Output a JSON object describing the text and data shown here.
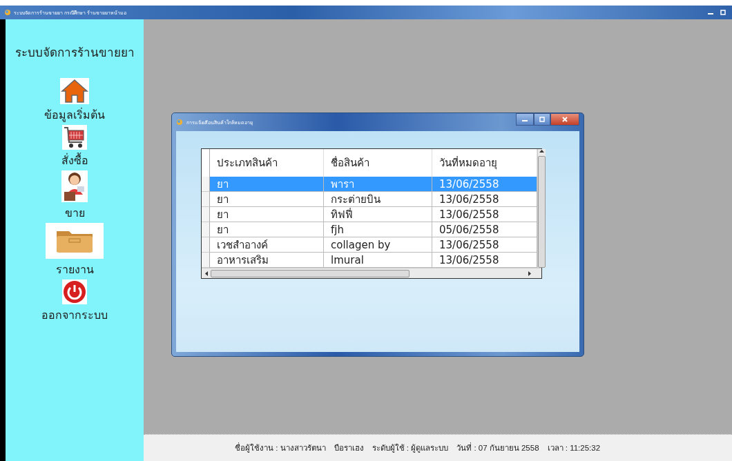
{
  "window": {
    "title": "ระบบจัดการร้านขายยา กรณีศึกษา ร้านขายยาหน้ามอ"
  },
  "sidebar": {
    "heading": "ระบบจัดการร้านขายยา",
    "items": [
      {
        "kind": "home",
        "label": "ข้อมูลเริ่มต้น"
      },
      {
        "kind": "cart",
        "label": "สั่งซื้อ"
      },
      {
        "kind": "seller",
        "label": "ขาย"
      },
      {
        "kind": "folder",
        "label": "รายงาน"
      },
      {
        "kind": "power",
        "label": "ออกจากระบบ"
      }
    ]
  },
  "dialog": {
    "title": "การแจ้งเตือนสินค้าใกล้หมดอายุ",
    "table": {
      "columns": [
        "ประเภทสินค้า",
        "ชื่อสินค้า",
        "วันที่หมดอายุ"
      ],
      "rows": [
        {
          "cells": [
            "ยา",
            "พารา",
            "13/06/2558"
          ],
          "selected": true
        },
        {
          "cells": [
            "ยา",
            "กระต่ายบิน",
            "13/06/2558"
          ],
          "selected": false
        },
        {
          "cells": [
            "ยา",
            "ทิฟฟี่",
            "13/06/2558"
          ],
          "selected": false
        },
        {
          "cells": [
            "ยา",
            "fjh",
            "05/06/2558"
          ],
          "selected": false
        },
        {
          "cells": [
            "เวชสำอางค์",
            "collagen by",
            "13/06/2558"
          ],
          "selected": false
        },
        {
          "cells": [
            "อาหารเสริม",
            "lmural",
            "13/06/2558"
          ],
          "selected": false
        }
      ]
    }
  },
  "status_bar": {
    "items": [
      "ชื่อผู้ใช้งาน : นางสาวรัตนา",
      "บือราเฮง",
      "ระดับผู้ใช้ : ผู้ดูแลระบบ",
      "วันที่ : 07 กันยายน 2558",
      "เวลา : 11:25:32"
    ]
  }
}
